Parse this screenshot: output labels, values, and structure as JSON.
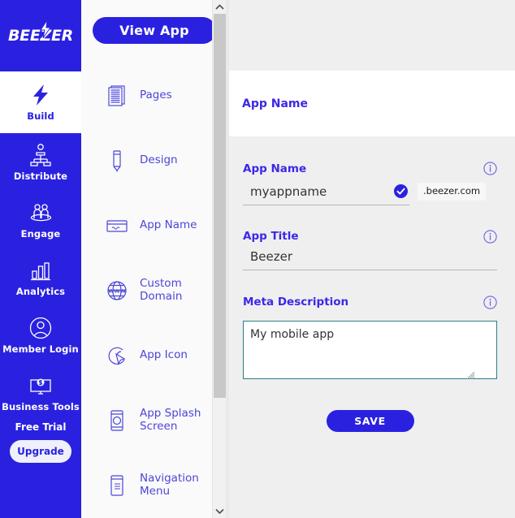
{
  "brand": {
    "logo_text": "BEEZER",
    "primary_color": "#2a21e0",
    "accent_color": "#3c28e8",
    "rail_bg": "#2a21e0",
    "panel_bg": "#fafafa",
    "main_bg": "#efefef",
    "textarea_border_color": "#2a7f8c"
  },
  "rail": {
    "items": [
      {
        "label": "Build",
        "icon": "bolt-icon",
        "active": true
      },
      {
        "label": "Distribute",
        "icon": "distribute-icon",
        "active": false
      },
      {
        "label": "Engage",
        "icon": "engage-people-icon",
        "active": false
      },
      {
        "label": "Analytics",
        "icon": "bar-chart-icon",
        "active": false
      },
      {
        "label": "Member Login",
        "icon": "user-circle-icon",
        "active": false
      },
      {
        "label": "Business Tools",
        "icon": "monitor-dollar-icon",
        "active": false
      }
    ],
    "free_trial_label": "Free Trial",
    "upgrade_label": "Upgrade"
  },
  "navpanel": {
    "view_app_label": "View App",
    "items": [
      {
        "label": "Pages",
        "icon": "pages-icon"
      },
      {
        "label": "Design",
        "icon": "pencil-icon"
      },
      {
        "label": "App Name",
        "icon": "browser-window-icon"
      },
      {
        "label": "Custom Domain",
        "icon": "www-globe-icon"
      },
      {
        "label": "App Icon",
        "icon": "cursor-click-icon"
      },
      {
        "label": "App Splash Screen",
        "icon": "phone-splash-icon"
      },
      {
        "label": "Navigation Menu",
        "icon": "phone-menu-icon"
      }
    ],
    "scrollbar": {
      "up_arrow": "chevron-up-icon",
      "down_arrow": "chevron-down-icon"
    }
  },
  "main": {
    "section_title": "App Name",
    "fields": {
      "app_name": {
        "label": "App Name",
        "value": "myappname",
        "placeholder": "",
        "domain_suffix": ".beezer.com",
        "validated": true,
        "info_icon": "info-icon"
      },
      "app_title": {
        "label": "App Title",
        "value": "Beezer",
        "placeholder": "",
        "info_icon": "info-icon"
      },
      "meta_description": {
        "label": "Meta Description",
        "value": "My mobile app",
        "placeholder": "",
        "info_icon": "info-icon",
        "focused": true
      }
    },
    "save_label": "SAVE"
  }
}
